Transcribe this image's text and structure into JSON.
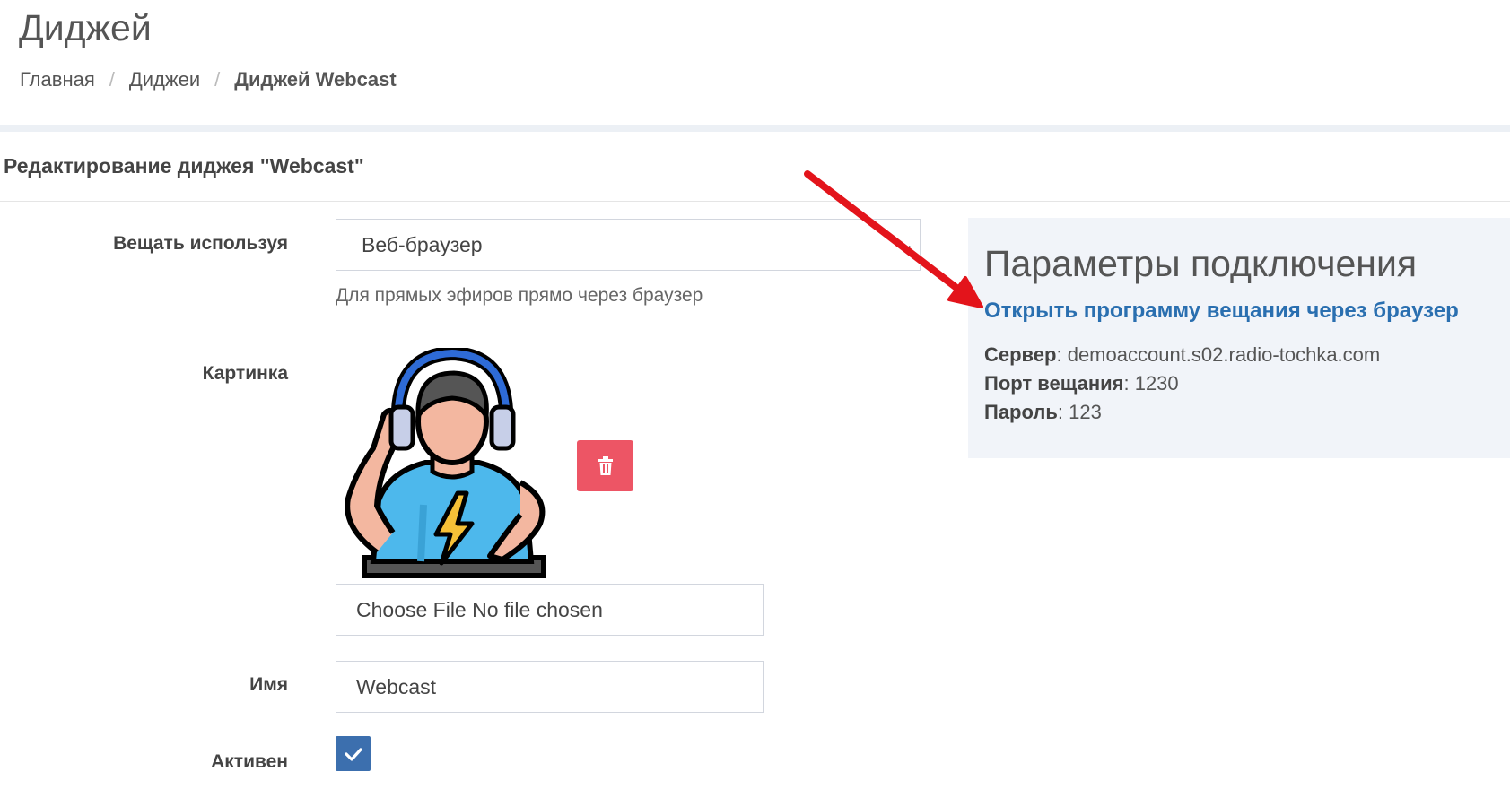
{
  "header": {
    "page_title": "Диджей"
  },
  "breadcrumb": {
    "home": "Главная",
    "separator": "/",
    "djs": "Диджеи",
    "current": "Диджей Webcast"
  },
  "form": {
    "box_title": "Редактирование диджея \"Webcast\"",
    "broadcast_label": "Вещать используя",
    "broadcast_value": "Веб-браузер",
    "broadcast_help": "Для прямых эфиров прямо через браузер",
    "picture_label": "Картинка",
    "file_input_text": "Choose File No file chosen",
    "name_label": "Имя",
    "name_value": "Webcast",
    "active_label": "Активен",
    "active_checked": true
  },
  "connection": {
    "title": "Параметры подключения",
    "open_link": "Открыть программу вещания через браузер",
    "server_label": "Сервер",
    "server_value": ": demoaccount.s02.radio-tochka.com",
    "port_label": "Порт вещания",
    "port_value": ": 1230",
    "password_label": "Пароль",
    "password_value": ": 123"
  },
  "icons": {
    "delete": "trash-icon",
    "checkbox": "check-icon",
    "select": "chevron-down-icon",
    "annotation": "red-arrow-icon"
  },
  "colors": {
    "link": "#2a6fb0",
    "delete_button": "#ed5565",
    "checkbox": "#3c6fae",
    "panel_bg": "#f1f4f9",
    "arrow": "#e3141b"
  }
}
